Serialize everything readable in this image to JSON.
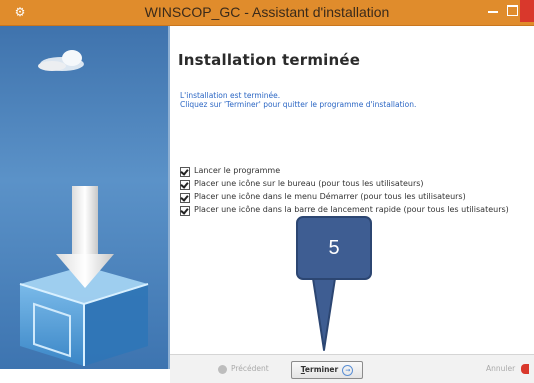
{
  "window": {
    "title": "WINSCOP_GC - Assistant d'installation"
  },
  "main": {
    "heading": "Installation terminée",
    "description_line1": "L'installation est terminée.",
    "description_line2": "Cliquez sur 'Terminer' pour quitter le programme d'installation.",
    "options": [
      {
        "label": "Lancer le programme",
        "checked": true
      },
      {
        "label": "Placer une icône sur le bureau (pour tous les utilisateurs)",
        "checked": true
      },
      {
        "label": "Placer une icône dans le menu Démarrer (pour tous les utilisateurs)",
        "checked": true
      },
      {
        "label": "Placer une icône dans la barre de lancement rapide (pour tous les utilisateurs)",
        "checked": true
      }
    ]
  },
  "footer": {
    "prev_label": "Précédent",
    "finish_label_underlined": "T",
    "finish_label_rest": "erminer",
    "finish_arrow": "→",
    "cancel_label": "Annuler"
  },
  "annotation": {
    "label": "5"
  },
  "colors": {
    "titlebar": "#e08c2c",
    "close": "#d9382c",
    "side_panel": "#4a82bd",
    "description_text": "#2c67c4",
    "callout": "#3e5d92"
  }
}
